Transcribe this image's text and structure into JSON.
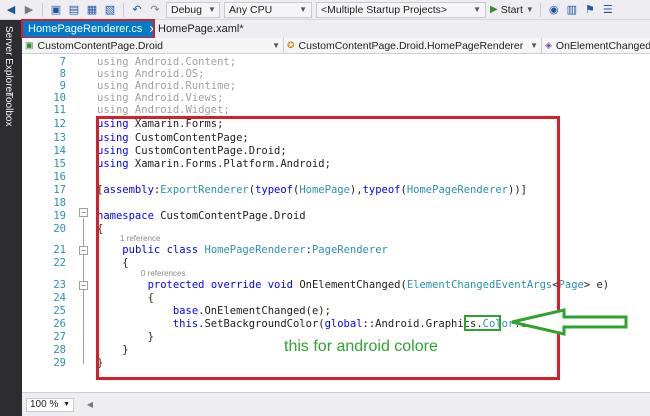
{
  "toolbar": {
    "configuration": "Debug",
    "platform": "Any CPU",
    "startup_projects": "<Multiple Startup Projects>",
    "start_label": "Start"
  },
  "side_panel": {
    "tabs": [
      "Server Explorer",
      "Toolbox"
    ]
  },
  "tabs": [
    {
      "label": "HomePageRenderer.cs",
      "active": true
    },
    {
      "label": "HomePage.xaml*",
      "active": false
    }
  ],
  "navbar": {
    "project": "CustomContentPage.Droid",
    "class": "CustomContentPage.Droid.HomePageRenderer",
    "member": "OnElementChanged(El"
  },
  "editor": {
    "lines": [
      {
        "num": "7",
        "text": "using Android.Content;"
      },
      {
        "num": "8",
        "text": "using Android.OS;"
      },
      {
        "num": "9",
        "text": "using Android.Runtime;"
      },
      {
        "num": "10",
        "text": "using Android.Views;"
      },
      {
        "num": "11",
        "text": "using Android.Widget;"
      },
      {
        "num": "12",
        "text": "using Xamarin.Forms;"
      },
      {
        "num": "13",
        "text": "using CustomContentPage;"
      },
      {
        "num": "14",
        "text": "using CustomContentPage.Droid;"
      },
      {
        "num": "15",
        "text": "using Xamarin.Forms.Platform.Android;"
      },
      {
        "num": "16",
        "text": ""
      },
      {
        "num": "17",
        "text": "[assembly:ExportRenderer(typeof(HomePage),typeof(HomePageRenderer))]"
      },
      {
        "num": "18",
        "text": ""
      },
      {
        "num": "19",
        "text": "namespace CustomContentPage.Droid"
      },
      {
        "num": "20",
        "text": "{"
      },
      {
        "num": "21",
        "text": "    public class HomePageRenderer:PageRenderer"
      },
      {
        "num": "22",
        "text": "    {"
      },
      {
        "num": "23",
        "text": "        protected override void OnElementChanged(ElementChangedEventArgs<Page> e)"
      },
      {
        "num": "24",
        "text": "        {"
      },
      {
        "num": "25",
        "text": "            base.OnElementChanged(e);"
      },
      {
        "num": "26",
        "text": "            this.SetBackgroundColor(global::Android.Graphics.Color.Green);"
      },
      {
        "num": "27",
        "text": "        }"
      },
      {
        "num": "28",
        "text": "    }"
      },
      {
        "num": "29",
        "text": "}"
      }
    ],
    "codelens_class": "1 reference",
    "codelens_method": "0 references"
  },
  "annotation": {
    "text": "this for android colore",
    "color": "#2fa32f"
  },
  "statusbar": {
    "zoom": "100 %"
  },
  "colors": {
    "accent": "#007acc",
    "highlight_red": "#d4202a",
    "keyword": "#0000ff",
    "type": "#2b91af"
  }
}
